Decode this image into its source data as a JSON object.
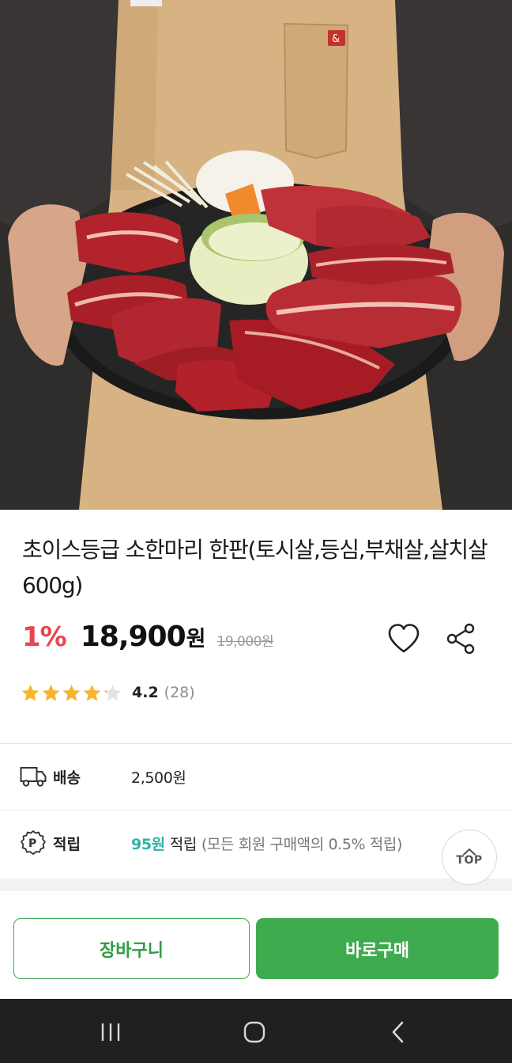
{
  "product": {
    "title": "초이스등급 소한마리 한판(토시살,등심,부채살,살치살 600g)",
    "discount": "1%",
    "price": "18,900",
    "price_unit": "원",
    "original_price": "19,000원"
  },
  "rating": {
    "score": "4.2",
    "count": "(28)",
    "stars_filled": 4,
    "stars_total": 5,
    "star_fraction_last": 0.2
  },
  "shipping": {
    "label": "배송",
    "value": "2,500원",
    "icon": "truck-icon"
  },
  "points": {
    "label": "적립",
    "amount": "95원",
    "word": "적립",
    "note": "(모든 회원 구매액의 0.5% 적립)",
    "icon": "point-icon"
  },
  "top_button": {
    "label": "TOP"
  },
  "actions": {
    "cart_label": "장바구니",
    "buy_label": "바로구매"
  },
  "colors": {
    "accent_green": "#3fab4f",
    "discount_red": "#e8474f",
    "point_teal": "#2fb3a8",
    "star_yellow": "#f7b52c"
  }
}
